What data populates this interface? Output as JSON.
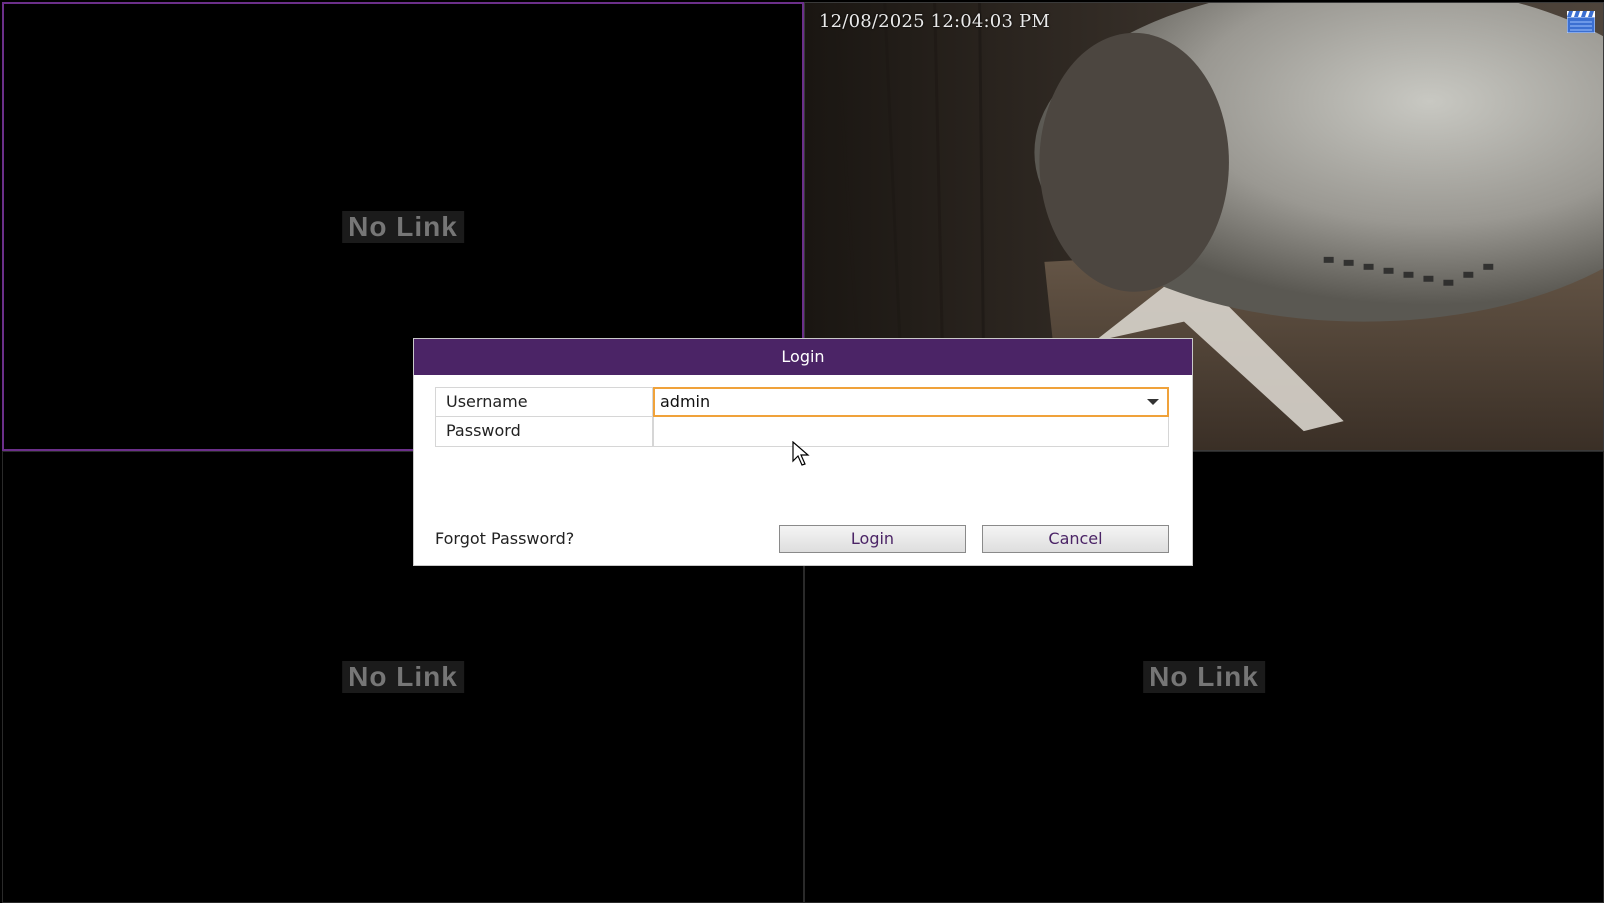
{
  "panes": {
    "pane1": {
      "status": "No Link"
    },
    "pane2": {
      "timestamp": "12/08/2025 12:04:03 PM",
      "icon": "recording-clapperboard-icon"
    },
    "pane3": {
      "status": "No Link"
    },
    "pane4": {
      "status": "No Link"
    }
  },
  "dialog": {
    "title": "Login",
    "username_label": "Username",
    "username_value": "admin",
    "password_label": "Password",
    "password_value": "",
    "forgot_link": "Forgot Password?",
    "login_button": "Login",
    "cancel_button": "Cancel"
  },
  "colors": {
    "accent": "#4b2466",
    "focus_border": "#f0a23a",
    "selected_pane_border": "#6b2f8a"
  }
}
